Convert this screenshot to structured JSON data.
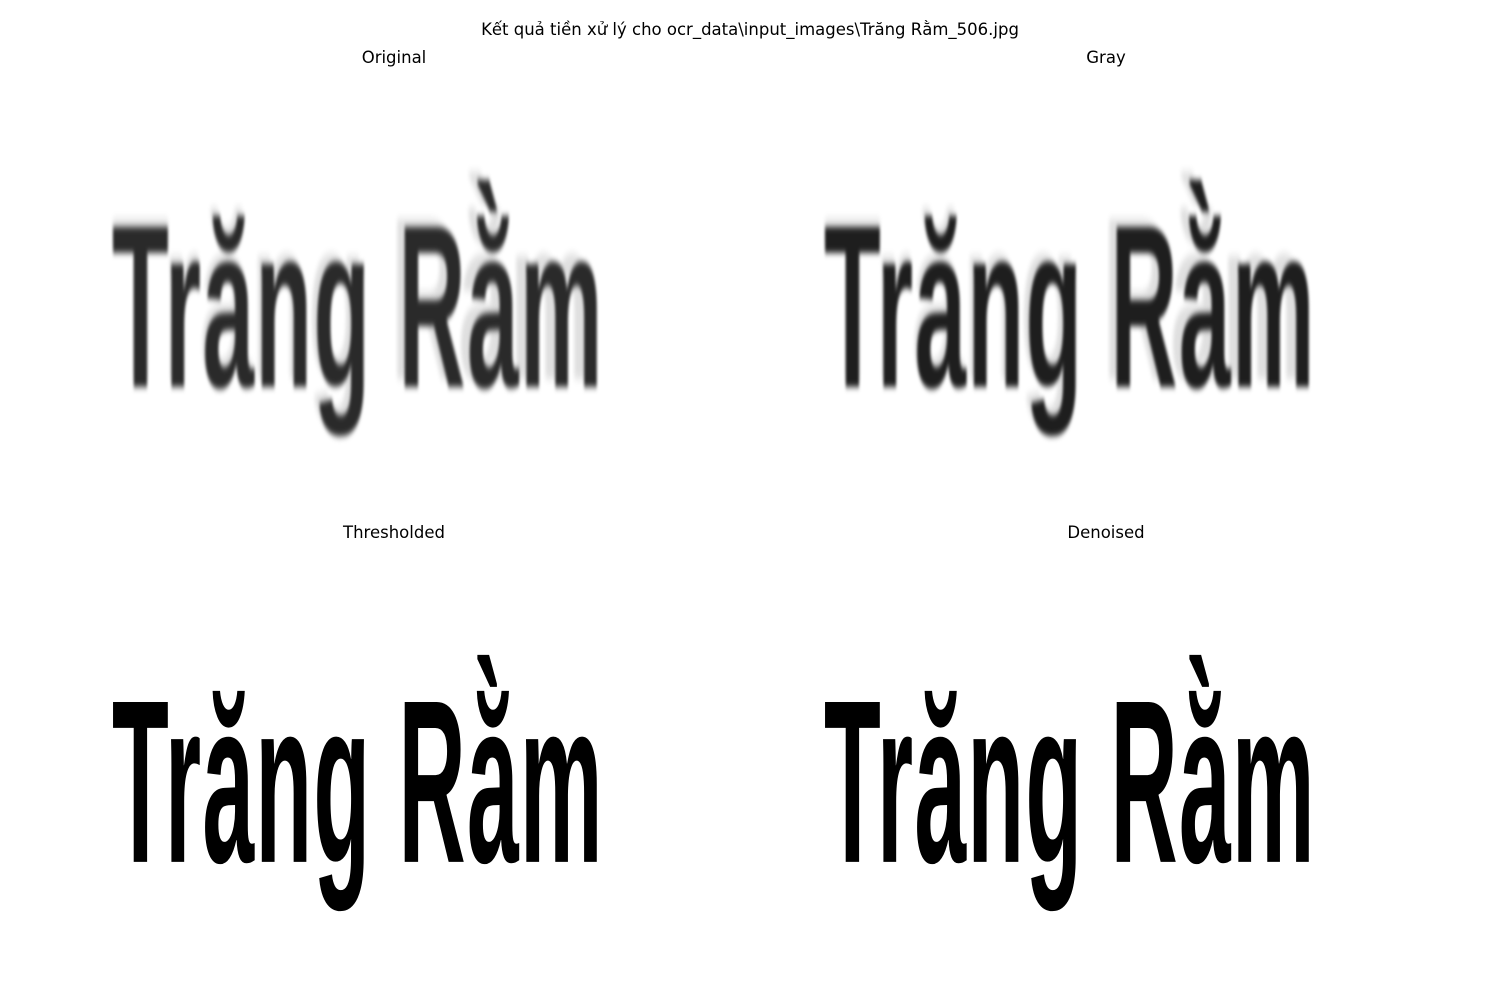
{
  "figure": {
    "title": "Kết quả tiền xử lý cho ocr_data\\input_images\\Trăng Rằm_506.jpg"
  },
  "panels": [
    {
      "title": "Original",
      "word": "Trăng Rằm",
      "style": "blur-soft"
    },
    {
      "title": "Gray",
      "word": "Trăng Rằm",
      "style": "blur-gray"
    },
    {
      "title": "Thresholded",
      "word": "Trăng Rằm",
      "style": "binary"
    },
    {
      "title": "Denoised",
      "word": "Trăng Rằm",
      "style": "binary"
    }
  ]
}
